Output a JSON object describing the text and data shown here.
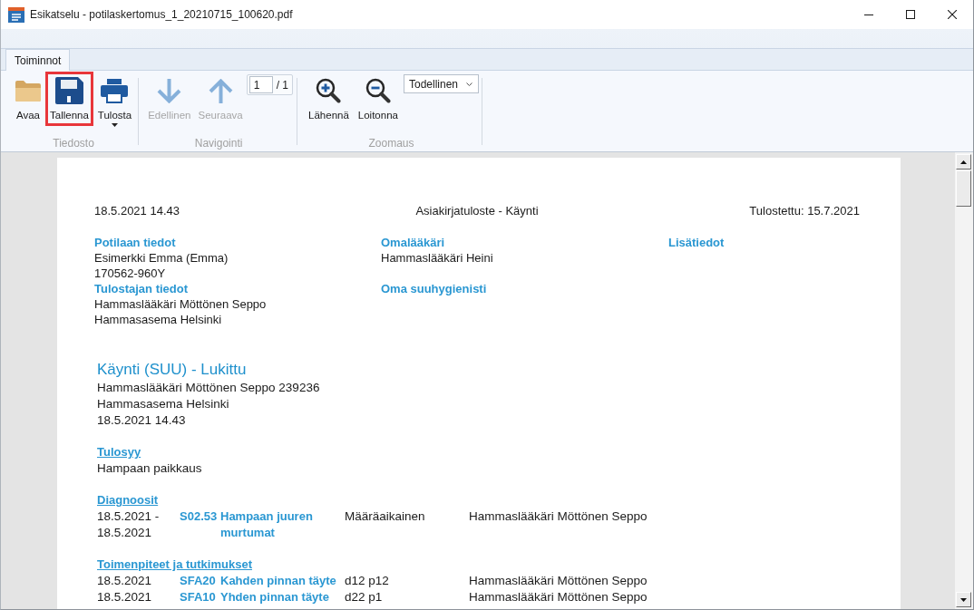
{
  "window": {
    "title": "Esikatselu - potilaskertomus_1_20210715_100620.pdf"
  },
  "ribbon": {
    "tabs": [
      {
        "label": "Toiminnot",
        "selected": true
      }
    ],
    "groups": [
      {
        "items": [
          {
            "kind": "button",
            "label": "Avaa",
            "disabled": false,
            "highlighted": false
          },
          {
            "kind": "button",
            "label": "Tallenna",
            "disabled": false,
            "highlighted": true
          },
          {
            "kind": "menu-button",
            "label": "Tulosta",
            "disabled": false,
            "highlighted": false
          }
        ],
        "label": "Tiedosto"
      },
      {
        "items": [
          {
            "kind": "button",
            "label": "Edellinen",
            "disabled": true,
            "highlighted": false
          },
          {
            "kind": "button",
            "label": "Seuraava",
            "disabled": true,
            "highlighted": false
          },
          {
            "kind": "page-field",
            "value": "1",
            "total": "/ 1",
            "disabled": false,
            "highlighted": false
          }
        ],
        "label": "Navigointi"
      },
      {
        "items": [
          {
            "kind": "button",
            "label": "Lähennä",
            "disabled": false,
            "highlighted": false
          },
          {
            "kind": "button",
            "label": "Loitonna",
            "disabled": false,
            "highlighted": false
          },
          {
            "kind": "dropdown",
            "value": "Todellinen",
            "disabled": false,
            "highlighted": false
          }
        ],
        "label": "Zoomaus"
      }
    ]
  },
  "document": {
    "header": {
      "date": "18.5.2021 14.43",
      "title": "Asiakirjatuloste - Käynti",
      "printed": "Tulostettu: 15.7.2021"
    },
    "info_rows": [
      {
        "cells": [
          {
            "heading": "Potilaan tiedot",
            "lines": [
              "Esimerkki Emma (Emma)",
              "170562-960Y"
            ]
          },
          {
            "heading": "Omalääkäri",
            "lines": [
              "Hammaslääkäri Heini"
            ]
          },
          {
            "heading": "Lisätiedot"
          }
        ]
      },
      {
        "cells": [
          {
            "heading": "Tulostajan tiedot",
            "lines": [
              "Hammaslääkäri Möttönen Seppo",
              "Hammasasema Helsinki"
            ]
          },
          {
            "heading": "Oma suuhygienisti"
          }
        ]
      }
    ],
    "visit": {
      "title": "Käynti (SUU) - Lukittu",
      "lines": [
        "Hammaslääkäri Möttönen Seppo 239236",
        "Hammasasema Helsinki",
        "18.5.2021 14.43"
      ],
      "sections": [
        {
          "kind": "text",
          "heading": "Tulosyy",
          "lines": [
            "Hampaan paikkaus"
          ]
        },
        {
          "kind": "table",
          "heading": "Diagnoosit",
          "rows": [
            {
              "date": "18.5.2021 - 18.5.2021",
              "code": "S02.53",
              "name": "Hampaan juuren murtumat",
              "detail": "Määräaikainen",
              "author": "Hammaslääkäri Möttönen Seppo"
            }
          ]
        },
        {
          "kind": "table",
          "heading": "Toimenpiteet ja tutkimukset",
          "rows": [
            {
              "date": "18.5.2021",
              "code": "SFA20",
              "name": "Kahden pinnan täyte",
              "detail": "d12 p12",
              "author": "Hammaslääkäri Möttönen Seppo"
            },
            {
              "date": "18.5.2021",
              "code": "SFA10",
              "name": "Yhden pinnan täyte",
              "detail": "d22 p1",
              "author": "Hammaslääkäri Möttönen Seppo"
            }
          ]
        }
      ]
    }
  }
}
